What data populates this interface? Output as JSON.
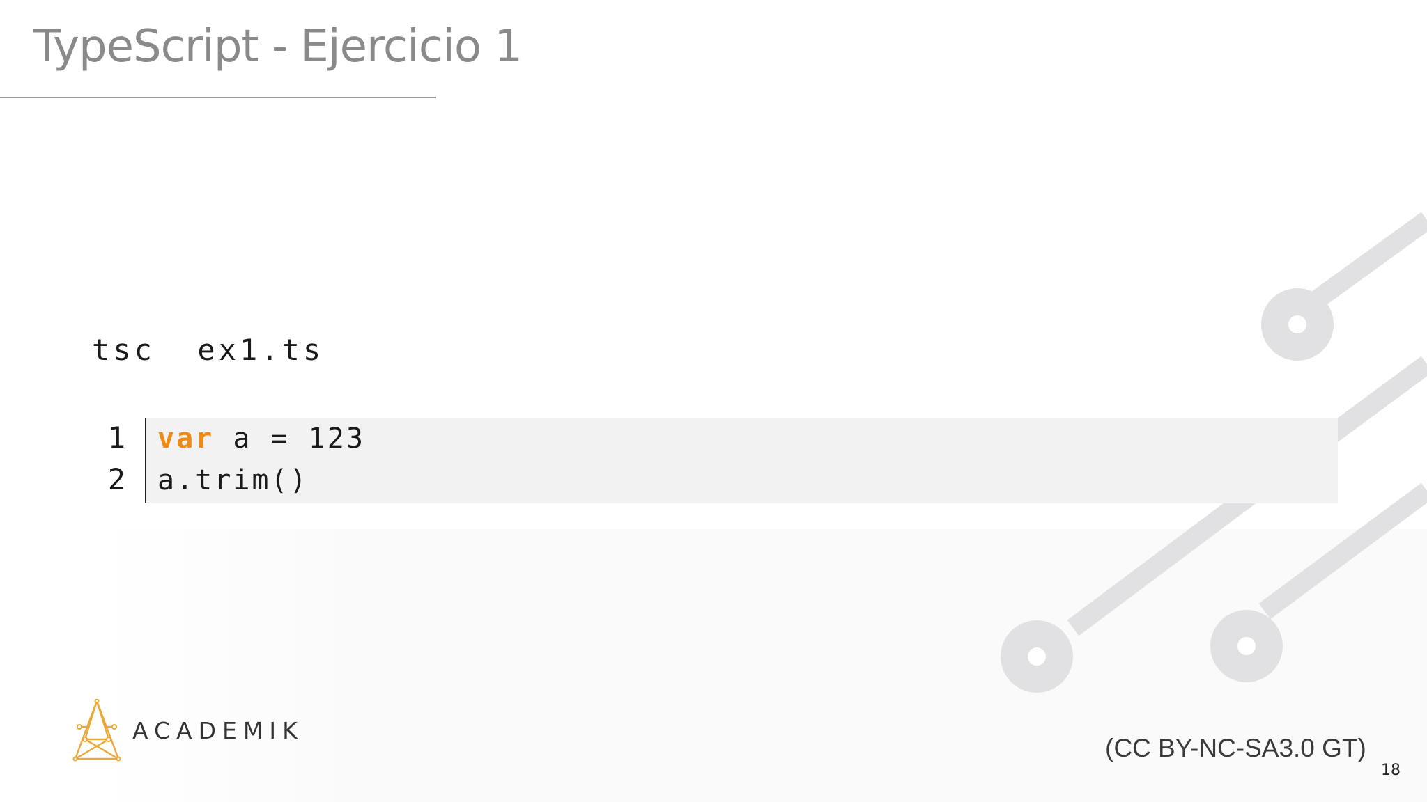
{
  "slide": {
    "title": "TypeScript - Ejercicio 1",
    "command": "tsc  ex1.ts",
    "code": {
      "lines": [
        {
          "number": "1",
          "keyword": "var",
          "rest": " a = 123"
        },
        {
          "number": "2",
          "keyword": "",
          "rest": "a.trim()"
        }
      ]
    },
    "logo_text": "ACADEMIK",
    "license": "(CC BY-NC-SA3.0 GT)",
    "page_number": "18"
  },
  "colors": {
    "title": "#8a8a8a",
    "keyword": "#f08a14",
    "circuit": "#e1e1e3",
    "logo": "#e8a93a"
  },
  "icons": {
    "logo": "academik-logo-icon",
    "background": "circuit-decoration"
  }
}
